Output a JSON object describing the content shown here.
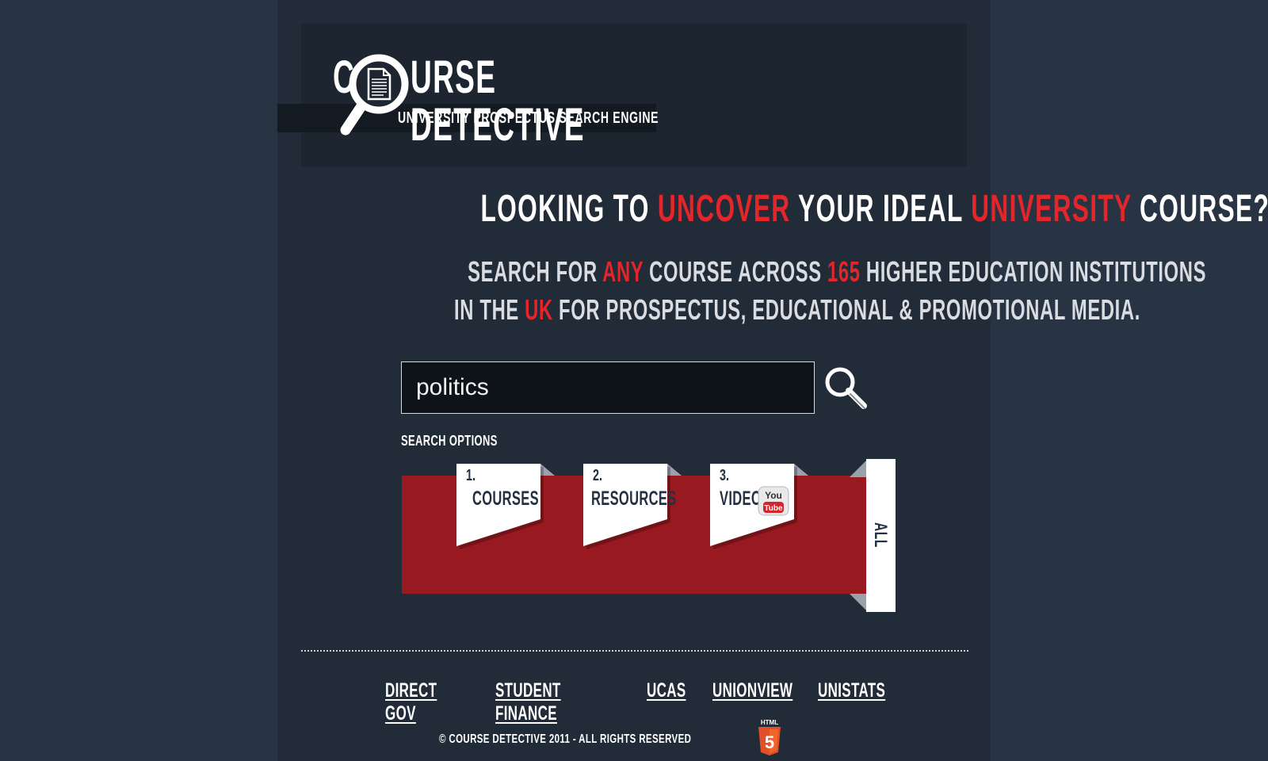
{
  "header": {
    "logo_first_letter": "C",
    "logo_rest": "URSE DETECTIVE",
    "subtitle": "UNIVERSITY PROSPECTUS SEARCH ENGINE"
  },
  "headline": {
    "part1": "LOOKING TO ",
    "highlight1": "UNCOVER",
    "part2": " YOUR IDEAL ",
    "highlight2": "UNIVERSITY",
    "part3": " COURSE?"
  },
  "tagline": {
    "line1_part1": "SEARCH FOR ",
    "line1_highlight1": "ANY",
    "line1_part2": " COURSE ACROSS ",
    "line1_highlight2": "165",
    "line1_part3": " HIGHER EDUCATION INSTITUTIONS",
    "line2_part1": "IN THE ",
    "line2_highlight": "UK",
    "line2_part2": " FOR PROSPECTUS, EDUCATIONAL & PROMOTIONAL MEDIA."
  },
  "search": {
    "value": "politics",
    "button_icon": "magnifier-icon",
    "options_label": "SEARCH OPTIONS"
  },
  "options": {
    "tabs": [
      {
        "number": "1.",
        "label": "COURSES"
      },
      {
        "number": "2.",
        "label": "RESOURCES"
      },
      {
        "number": "3.",
        "label": "VIDEO",
        "icon": "youtube-icon",
        "icon_text_top": "You",
        "icon_text_bottom": "Tube"
      }
    ],
    "all_label": "ALL"
  },
  "footer": {
    "links": [
      "DIRECT GOV",
      "STUDENT FINANCE",
      "UCAS",
      "UNIONVIEW",
      "UNISTATS"
    ],
    "copyright": "© COURSE DETECTIVE 2011 - ALL RIGHTS RESERVED",
    "badge_text": "HTML",
    "badge_number": "5"
  },
  "colors": {
    "background": "#283444",
    "page": "#222b38",
    "accent_red": "#e4262a",
    "panel_red": "#981a20",
    "text_dark": "#253042"
  }
}
